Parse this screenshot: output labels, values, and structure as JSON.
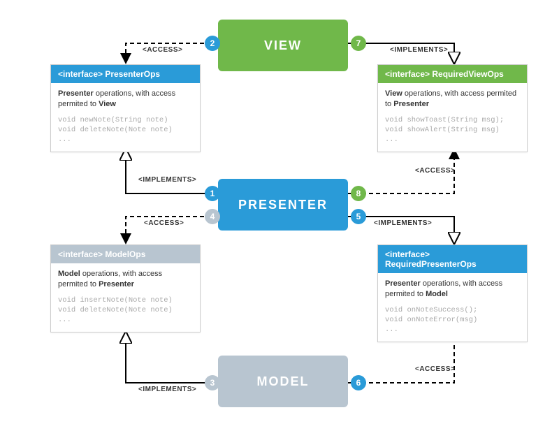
{
  "layers": {
    "view": "VIEW",
    "presenter": "PRESENTER",
    "model": "MODEL"
  },
  "iface": {
    "presenterOps": {
      "head": "<interface> PresenterOps",
      "desc_main": "Presenter",
      "desc_tail": " operations, with access permited to ",
      "desc_to": "View",
      "code": "void newNote(String note)\nvoid deleteNote(Note note)\n..."
    },
    "requiredViewOps": {
      "head": "<interface> RequiredViewOps",
      "desc_main": "View",
      "desc_tail": " operations, with access permited to ",
      "desc_to": "Presenter",
      "code": "void showToast(String msg);\nvoid showAlert(String msg)\n..."
    },
    "modelOps": {
      "head": "<interface> ModelOps",
      "desc_main": "Model",
      "desc_tail": " operations, with access permited to ",
      "desc_to": "Presenter",
      "code": "void insertNote(Note note)\nvoid deleteNote(Note note)\n..."
    },
    "requiredPresenterOps": {
      "head": "<interface> RequiredPresenterOps",
      "desc_main": "Presenter",
      "desc_tail": " operations, with access permited to ",
      "desc_to": "Model",
      "code": "void onNoteSuccess();\nvoid onNoteError(msg)\n..."
    }
  },
  "labels": {
    "access": "<ACCESS>",
    "implements": "<IMPLEMENTS>"
  },
  "badges": {
    "b1": "1",
    "b2": "2",
    "b3": "3",
    "b4": "4",
    "b5": "5",
    "b6": "6",
    "b7": "7",
    "b8": "8"
  }
}
